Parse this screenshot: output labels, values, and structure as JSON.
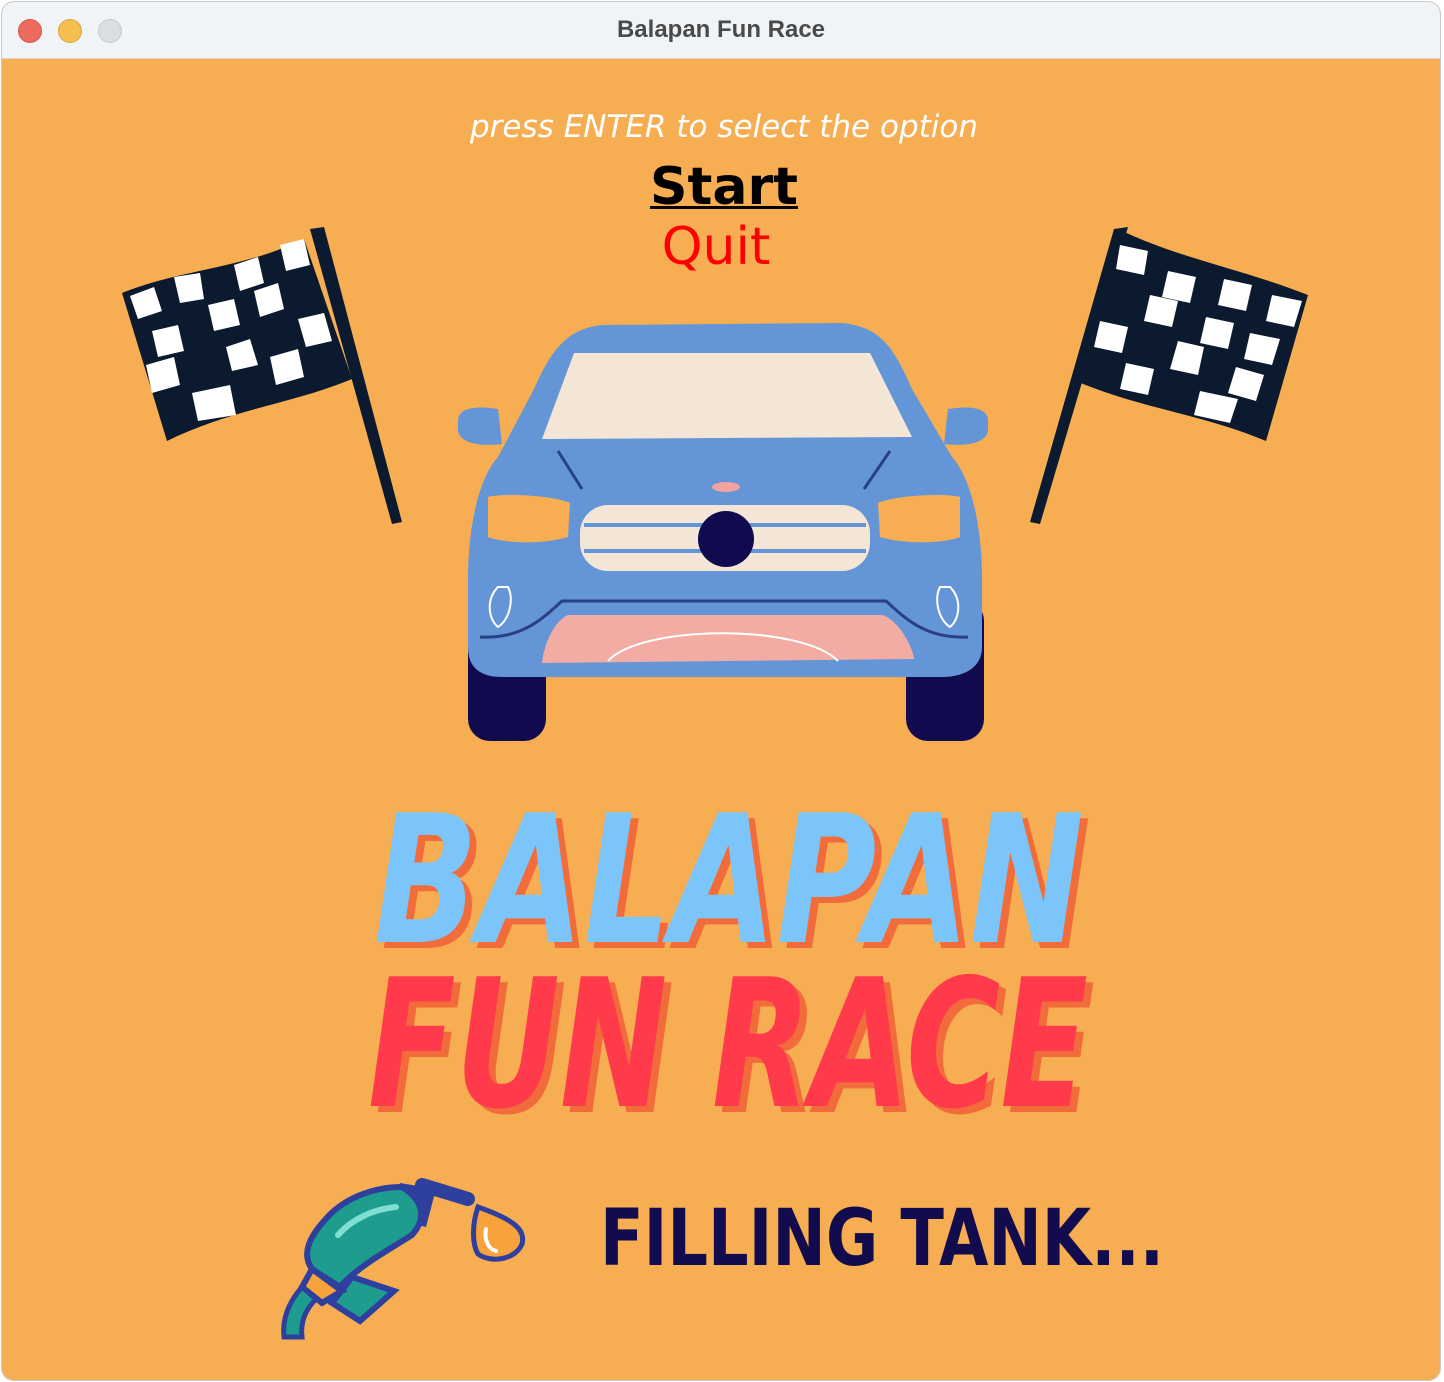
{
  "window": {
    "title": "Balapan Fun Race"
  },
  "menu": {
    "hint": "press ENTER to select the option",
    "options": [
      "Start",
      "Quit"
    ],
    "selected": "Start"
  },
  "logo": {
    "line1": "BALAPAN",
    "line2": "FUN RACE"
  },
  "loading": {
    "text": "FILLING TANK...",
    "icon": "fuel-nozzle-icon"
  },
  "colors": {
    "background": "#F7AE52",
    "logo_line1": "#7CC5FA",
    "logo_line2": "#FF3B4B",
    "logo_shadow": "#F26B3A",
    "loading_text": "#120C4E",
    "quit": "#FF0000"
  }
}
